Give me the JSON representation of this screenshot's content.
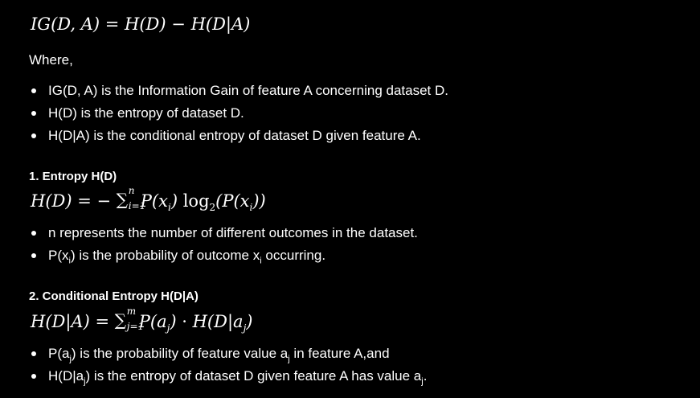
{
  "formula_ig": {
    "lhs": "IG(D, A)",
    "eq": "=",
    "t1": "H(D)",
    "minus": "−",
    "t2": "H(D|A)"
  },
  "where_label": "Where,",
  "ig_bullets": [
    "IG(D, A) is the Information Gain of feature A concerning dataset D.",
    "H(D) is the entropy of dataset D.",
    "H(D|A) is the conditional entropy of dataset D given feature A."
  ],
  "section1": {
    "heading": "1. Entropy H(D)",
    "formula": {
      "lhs": "H(D)",
      "eq": "= −",
      "sigma": "∑",
      "upper": "n",
      "lower": "i=1",
      "p": "P(x",
      "p_sub": "i",
      "p_close": ")",
      "log": "log",
      "log_sub": "2",
      "arg_open": "(P(x",
      "arg_sub": "i",
      "arg_close": "))"
    },
    "bullets": [
      {
        "pre": "n represents the number of different outcomes in the dataset.",
        "sub": "",
        "post": "",
        "sub2": "",
        "post2": ""
      },
      {
        "pre": "P(x",
        "sub": "i",
        "post": ") is the probability of outcome x",
        "sub2": "i",
        "post2": " occurring."
      }
    ]
  },
  "section2": {
    "heading": "2. Conditional Entropy H(D|A)",
    "formula": {
      "lhs": "H(D|A)",
      "eq": "=",
      "sigma": "∑",
      "upper": "m",
      "lower": "j=1",
      "p": "P(a",
      "p_sub": "j",
      "p_close": ")",
      "dot": "·",
      "h": "H(D|a",
      "h_sub": "j",
      "h_close": ")"
    },
    "bullets": [
      {
        "pre": "P(a",
        "sub": "j",
        "post": ") is the probability of feature value a",
        "sub2": "j",
        "post2": " in feature A,and"
      },
      {
        "pre": "H(D|a",
        "sub": "j",
        "post": ") is the entropy of dataset D given feature A has value a",
        "sub2": "j",
        "post2": "."
      }
    ]
  }
}
